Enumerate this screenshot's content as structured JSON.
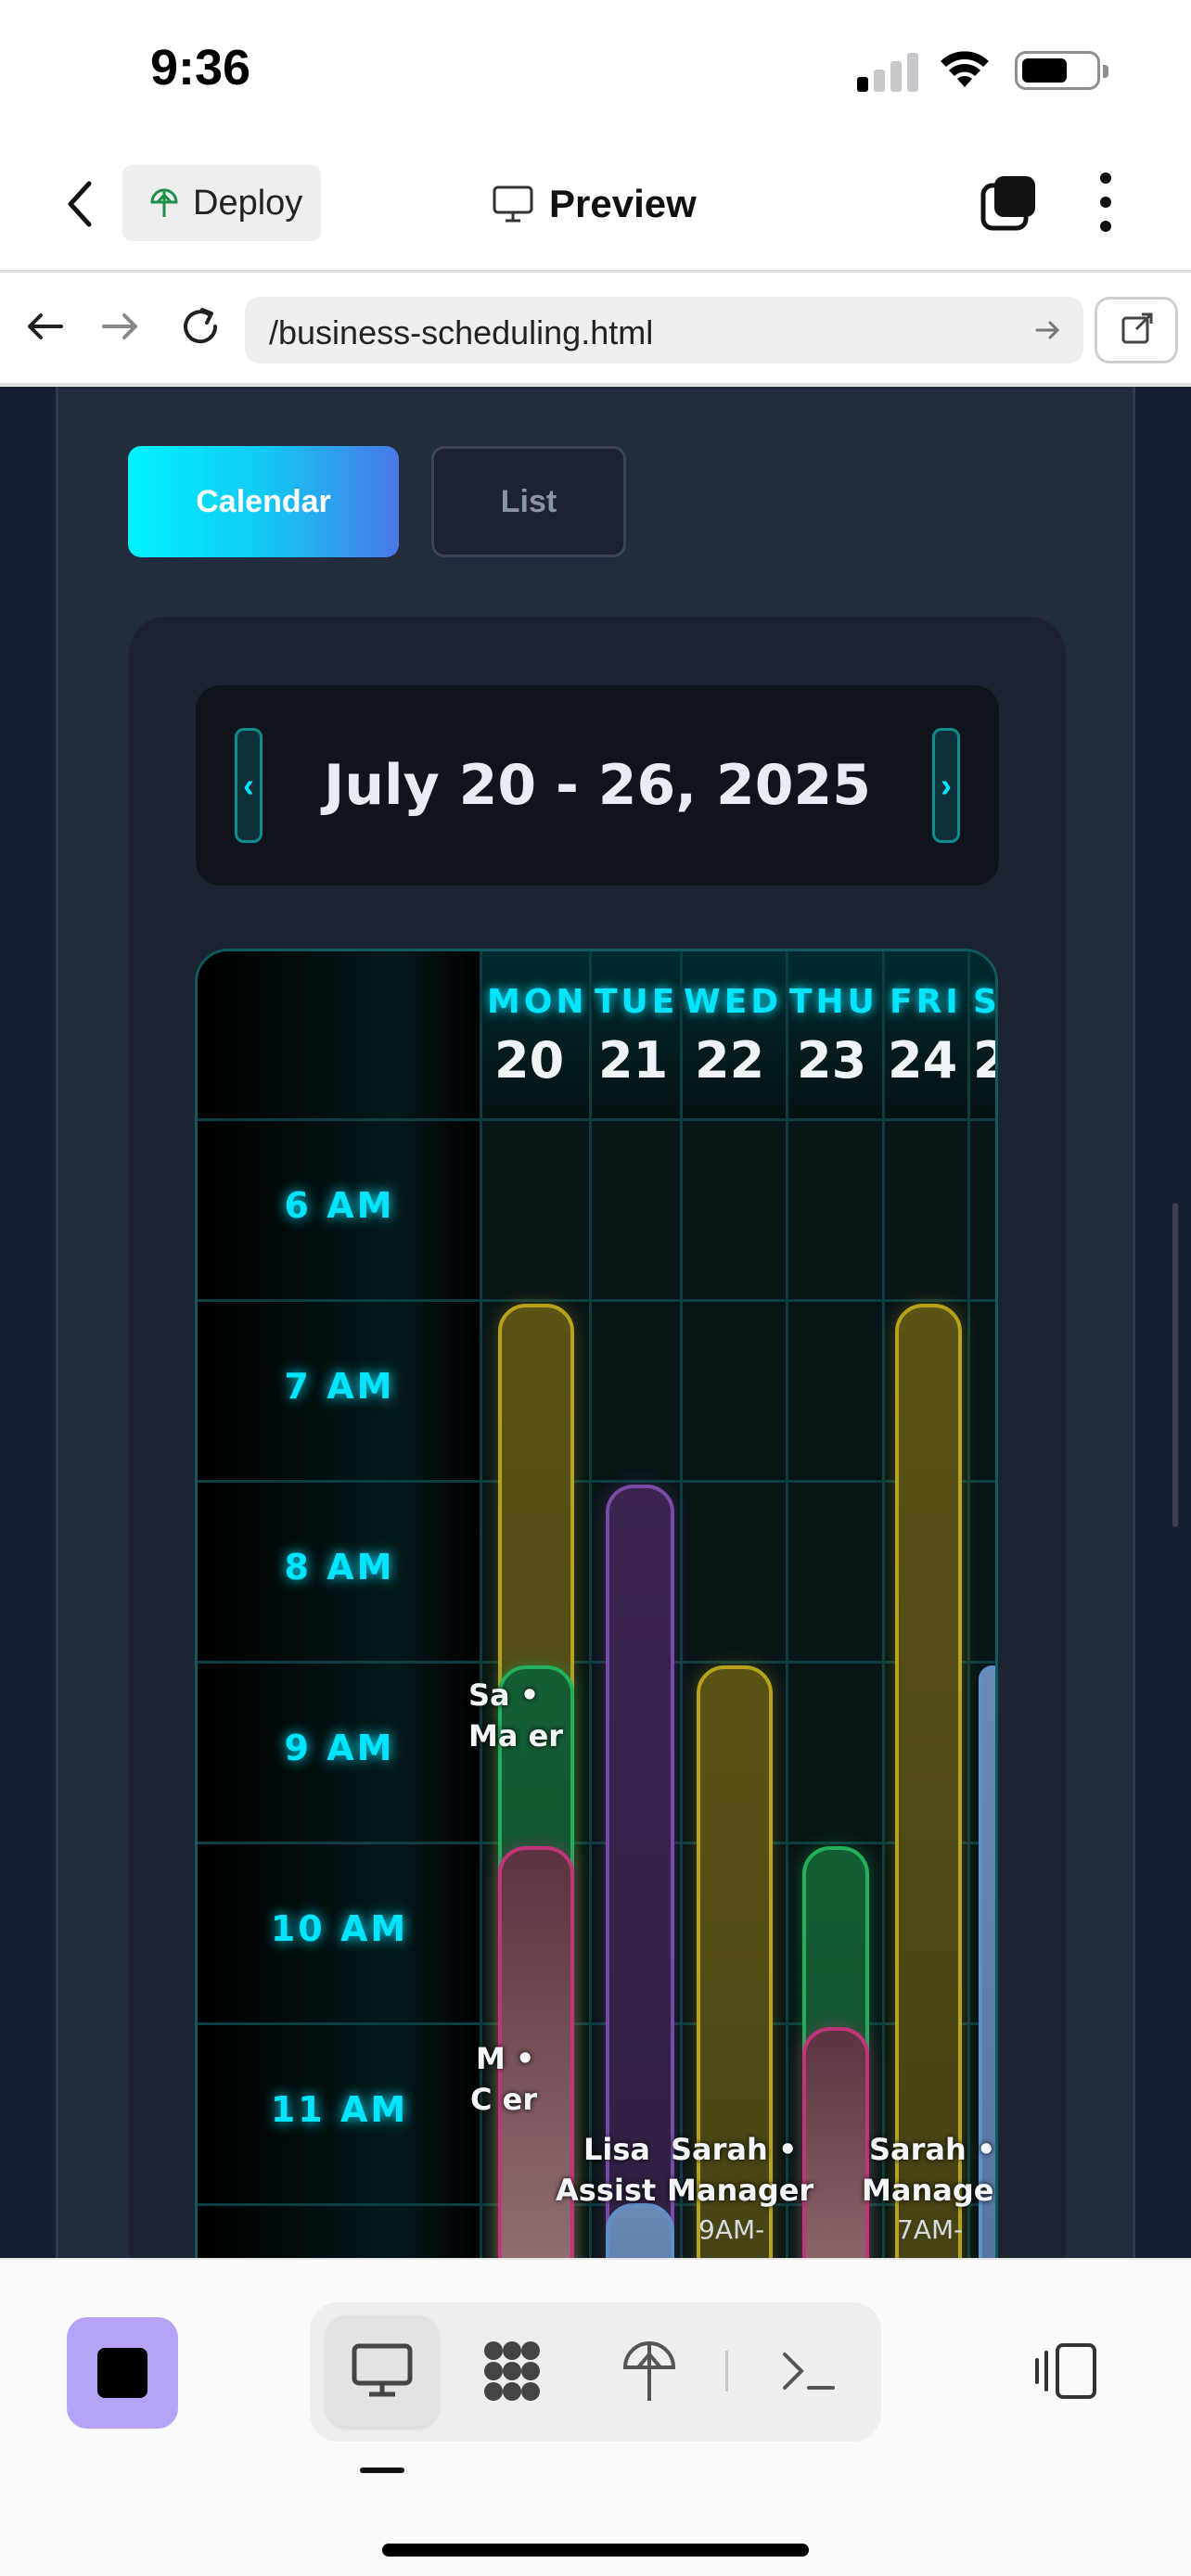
{
  "status_bar": {
    "time": "9:36"
  },
  "header": {
    "deploy_label": "Deploy",
    "preview_label": "Preview"
  },
  "url_bar": {
    "url": "/business-scheduling.html"
  },
  "page": {
    "view_tabs": [
      {
        "label": "Calendar",
        "active": true
      },
      {
        "label": "List",
        "active": false
      }
    ],
    "week": {
      "label": "July 20 - 26, 2025",
      "prev_arrow": "‹",
      "next_arrow": "›"
    },
    "days": [
      {
        "name": "MON",
        "num": "20"
      },
      {
        "name": "TUE",
        "num": "21"
      },
      {
        "name": "WED",
        "num": "22"
      },
      {
        "name": "THU",
        "num": "23"
      },
      {
        "name": "FRI",
        "num": "24"
      },
      {
        "name": "S",
        "num": "2"
      }
    ],
    "times": [
      "6 AM",
      "7 AM",
      "8 AM",
      "9 AM",
      "10 AM",
      "11 AM"
    ],
    "event_labels": {
      "mon_green": "Sa  •",
      "mon_green_2": "Ma   er",
      "mon_pink": "M   •",
      "mon_pink_2": "C    er",
      "tue": "Lisa",
      "tue_2": "Assist",
      "wed": "Sarah •",
      "wed_2": "Manager",
      "wed_time": "9AM-",
      "fri": "Sarah •",
      "fri_2": "Manage",
      "fri_time": "7AM-"
    },
    "colors": {
      "accent_cyan": "#00e5ff",
      "event_yellow": "#b7a21a",
      "event_purple": "#7a4aa6",
      "event_green": "#22b05a",
      "event_pink": "#c2337a"
    }
  },
  "toolbar": {
    "icons": [
      "stop-icon",
      "desktop-icon",
      "apps-icon",
      "deploy-icon",
      "terminal-icon",
      "panel-icon"
    ]
  }
}
